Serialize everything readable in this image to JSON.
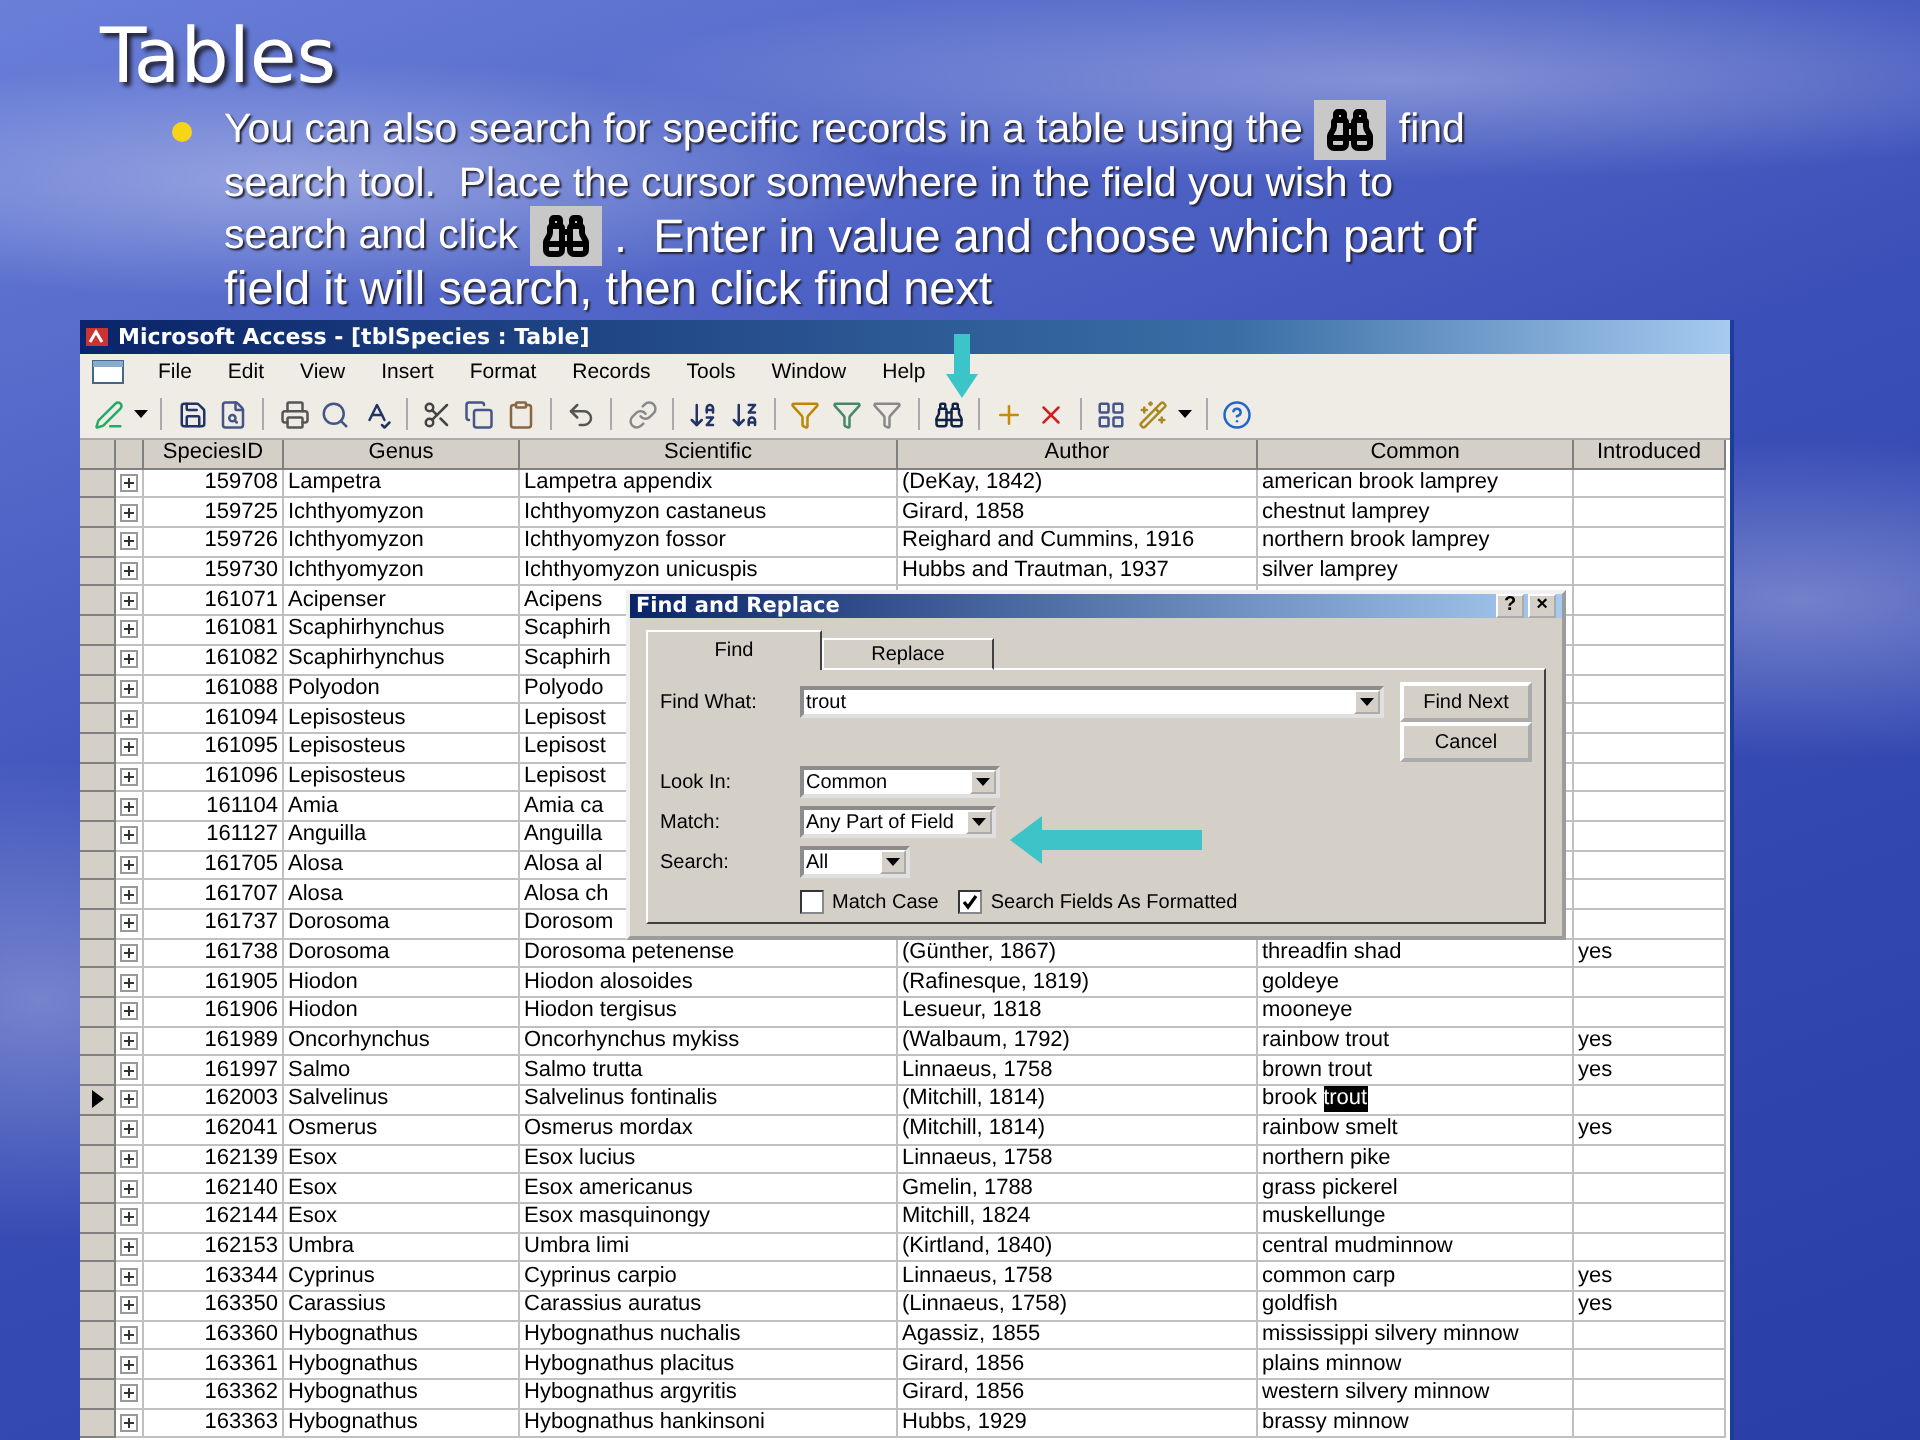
{
  "slide": {
    "title": "Tables",
    "bullet": [
      [
        {
          "kind": "text",
          "text": "You can also search for specific records in a table using the",
          "large": false
        },
        {
          "kind": "icon"
        },
        {
          "kind": "text",
          "text": "find",
          "large": false
        }
      ],
      [
        {
          "kind": "text",
          "text": "search tool.  Place the cursor somewhere in the field you wish to",
          "large": false
        }
      ],
      [
        {
          "kind": "text",
          "text": "search and click",
          "large": false
        },
        {
          "kind": "icon"
        },
        {
          "kind": "text",
          "text": ".  Enter in value and choose which part of",
          "large": true
        }
      ],
      [
        {
          "kind": "text",
          "text": "field it will search, then click find next",
          "large": true
        }
      ]
    ]
  },
  "window": {
    "title": "Microsoft Access - [tblSpecies : Table]"
  },
  "menu": [
    "File",
    "Edit",
    "View",
    "Insert",
    "Format",
    "Records",
    "Tools",
    "Window",
    "Help"
  ],
  "table": {
    "columns": [
      "SpeciesID",
      "Genus",
      "Scientific",
      "Author",
      "Common",
      "Introduced"
    ],
    "rows": [
      {
        "id": "159708",
        "genus": "Lampetra",
        "scientific": "Lampetra appendix",
        "author": "(DeKay, 1842)",
        "common": "american brook lamprey",
        "current": false
      },
      {
        "id": "159725",
        "genus": "Ichthyomyzon",
        "scientific": "Ichthyomyzon castaneus",
        "author": "Girard, 1858",
        "common": "chestnut lamprey",
        "current": false
      },
      {
        "id": "159726",
        "genus": "Ichthyomyzon",
        "scientific": "Ichthyomyzon fossor",
        "author": "Reighard and Cummins, 1916",
        "common": "northern brook lamprey",
        "current": false
      },
      {
        "id": "159730",
        "genus": "Ichthyomyzon",
        "scientific": "Ichthyomyzon unicuspis",
        "author": "Hubbs and Trautman, 1937",
        "common": "silver lamprey",
        "current": false
      },
      {
        "id": "161071",
        "genus": "Acipenser",
        "scientific": "Acipens",
        "current": false
      },
      {
        "id": "161081",
        "genus": "Scaphirhynchus",
        "scientific": "Scaphirh",
        "current": false
      },
      {
        "id": "161082",
        "genus": "Scaphirhynchus",
        "scientific": "Scaphirh",
        "current": false
      },
      {
        "id": "161088",
        "genus": "Polyodon",
        "scientific": "Polyodo",
        "current": false
      },
      {
        "id": "161094",
        "genus": "Lepisosteus",
        "scientific": "Lepisost",
        "current": false
      },
      {
        "id": "161095",
        "genus": "Lepisosteus",
        "scientific": "Lepisost",
        "current": false
      },
      {
        "id": "161096",
        "genus": "Lepisosteus",
        "scientific": "Lepisost",
        "current": false
      },
      {
        "id": "161104",
        "genus": "Amia",
        "scientific": "Amia ca",
        "current": false
      },
      {
        "id": "161127",
        "genus": "Anguilla",
        "scientific": "Anguilla",
        "current": false
      },
      {
        "id": "161705",
        "genus": "Alosa",
        "scientific": "Alosa al",
        "current": false
      },
      {
        "id": "161707",
        "genus": "Alosa",
        "scientific": "Alosa ch",
        "current": false
      },
      {
        "id": "161737",
        "genus": "Dorosoma",
        "scientific": "Dorosom",
        "current": false
      },
      {
        "id": "161738",
        "genus": "Dorosoma",
        "scientific": "Dorosoma petenense",
        "author": "(Günther, 1867)",
        "common": "threadfin shad",
        "introduced": "yes",
        "current": false
      },
      {
        "id": "161905",
        "genus": "Hiodon",
        "scientific": "Hiodon alosoides",
        "author": "(Rafinesque, 1819)",
        "common": "goldeye",
        "current": false
      },
      {
        "id": "161906",
        "genus": "Hiodon",
        "scientific": "Hiodon tergisus",
        "author": "Lesueur, 1818",
        "common": "mooneye",
        "current": false
      },
      {
        "id": "161989",
        "genus": "Oncorhynchus",
        "scientific": "Oncorhynchus mykiss",
        "author": "(Walbaum, 1792)",
        "common": "rainbow trout",
        "introduced": "yes",
        "current": false
      },
      {
        "id": "161997",
        "genus": "Salmo",
        "scientific": "Salmo trutta",
        "author": "Linnaeus, 1758",
        "common": "brown trout",
        "introduced": "yes",
        "current": false
      },
      {
        "id": "162003",
        "genus": "Salvelinus",
        "scientific": "Salvelinus fontinalis",
        "author": "(Mitchill, 1814)",
        "common": "brook ",
        "found": "trout",
        "current": true
      },
      {
        "id": "162041",
        "genus": "Osmerus",
        "scientific": "Osmerus mordax",
        "author": "(Mitchill, 1814)",
        "common": "rainbow smelt",
        "introduced": "yes",
        "current": false
      },
      {
        "id": "162139",
        "genus": "Esox",
        "scientific": "Esox lucius",
        "author": "Linnaeus, 1758",
        "common": "northern pike",
        "current": false
      },
      {
        "id": "162140",
        "genus": "Esox",
        "scientific": "Esox americanus",
        "author": "Gmelin, 1788",
        "common": "grass pickerel",
        "current": false
      },
      {
        "id": "162144",
        "genus": "Esox",
        "scientific": "Esox masquinongy",
        "author": "Mitchill, 1824",
        "common": "muskellunge",
        "current": false
      },
      {
        "id": "162153",
        "genus": "Umbra",
        "scientific": "Umbra limi",
        "author": "(Kirtland, 1840)",
        "common": "central mudminnow",
        "current": false
      },
      {
        "id": "163344",
        "genus": "Cyprinus",
        "scientific": "Cyprinus carpio",
        "author": "Linnaeus, 1758",
        "common": "common carp",
        "introduced": "yes",
        "current": false
      },
      {
        "id": "163350",
        "genus": "Carassius",
        "scientific": "Carassius auratus",
        "author": "(Linnaeus, 1758)",
        "common": "goldfish",
        "introduced": "yes",
        "current": false
      },
      {
        "id": "163360",
        "genus": "Hybognathus",
        "scientific": "Hybognathus nuchalis",
        "author": "Agassiz, 1855",
        "common": "mississippi silvery minnow",
        "current": false
      },
      {
        "id": "163361",
        "genus": "Hybognathus",
        "scientific": "Hybognathus placitus",
        "author": "Girard, 1856",
        "common": "plains minnow",
        "current": false
      },
      {
        "id": "163362",
        "genus": "Hybognathus",
        "scientific": "Hybognathus argyritis",
        "author": "Girard, 1856",
        "common": "western silvery minnow",
        "current": false
      },
      {
        "id": "163363",
        "genus": "Hybognathus",
        "scientific": "Hybognathus hankinsoni",
        "author": "Hubbs, 1929",
        "common": "brassy minnow",
        "current": false
      }
    ]
  },
  "dialog": {
    "title": "Find and Replace",
    "help_button": "?",
    "close_button": "×",
    "tabs": [
      {
        "label": "Find",
        "selected": true
      },
      {
        "label": "Replace",
        "selected": false
      }
    ],
    "find_what": {
      "label": "Find What:",
      "value": "trout"
    },
    "buttons": [
      "Find Next",
      "Cancel"
    ],
    "look_in": {
      "label": "Look In:",
      "value": "Common"
    },
    "match": {
      "label": "Match:",
      "value": "Any Part of Field"
    },
    "search": {
      "label": "Search:",
      "value": "All"
    },
    "checkboxes": [
      {
        "label": "Match Case",
        "checked": false
      },
      {
        "label": "Search Fields As Formatted",
        "checked": true
      }
    ]
  }
}
